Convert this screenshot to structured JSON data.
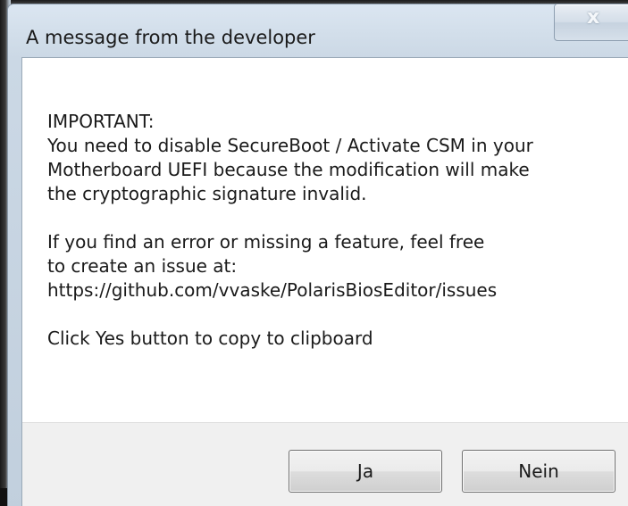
{
  "window": {
    "title": "A message from the developer",
    "close_icon": "close-icon",
    "close_glyph": "x"
  },
  "message": {
    "lines": [
      "IMPORTANT:",
      "You need to disable SecureBoot / Activate CSM in your",
      "Motherboard UEFI because the modification will make",
      "the cryptographic signature invalid.",
      "",
      "If you find an error or missing a feature, feel free",
      "to create an issue at:",
      "https://github.com/vvaske/PolarisBiosEditor/issues",
      "",
      "Click Yes button to copy to clipboard"
    ]
  },
  "buttons": {
    "yes_label": "Ja",
    "no_label": "Nein"
  }
}
